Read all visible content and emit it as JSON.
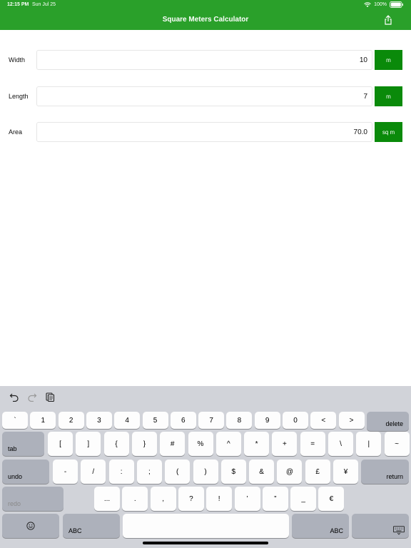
{
  "status_bar": {
    "time": "12:15 PM",
    "date": "Sun Jul 25",
    "battery": "100%"
  },
  "app": {
    "title": "Square Meters Calculator",
    "accent_color": "#2aa02a",
    "unit_color": "#0a8a0a"
  },
  "fields": [
    {
      "label": "Width",
      "value": "10",
      "unit": "m"
    },
    {
      "label": "Length",
      "value": "7",
      "unit": "m"
    },
    {
      "label": "Area",
      "value": "70.0",
      "unit": "sq m"
    }
  ],
  "keyboard": {
    "toolbar": [
      "undo-icon",
      "redo-icon",
      "paste-icon"
    ],
    "row1": [
      "`",
      "1",
      "2",
      "3",
      "4",
      "5",
      "6",
      "7",
      "8",
      "9",
      "0",
      "<",
      ">"
    ],
    "row1_delete": "delete",
    "row2_tab": "tab",
    "row2": [
      "[",
      "]",
      "{",
      "}",
      "#",
      "%",
      "^",
      "*",
      "+",
      "=",
      "\\",
      "|",
      "~"
    ],
    "row3_undo": "undo",
    "row3": [
      "-",
      "/",
      ":",
      ";",
      "(",
      ")",
      "$",
      "&",
      "@",
      "£",
      "¥"
    ],
    "row3_return": "return",
    "row4_redo": "redo",
    "row4": [
      "...",
      ".",
      ",",
      "?",
      "!",
      "’",
      "”",
      "_",
      "€"
    ],
    "row5_abc_left": "ABC",
    "row5_abc_right": "ABC"
  }
}
